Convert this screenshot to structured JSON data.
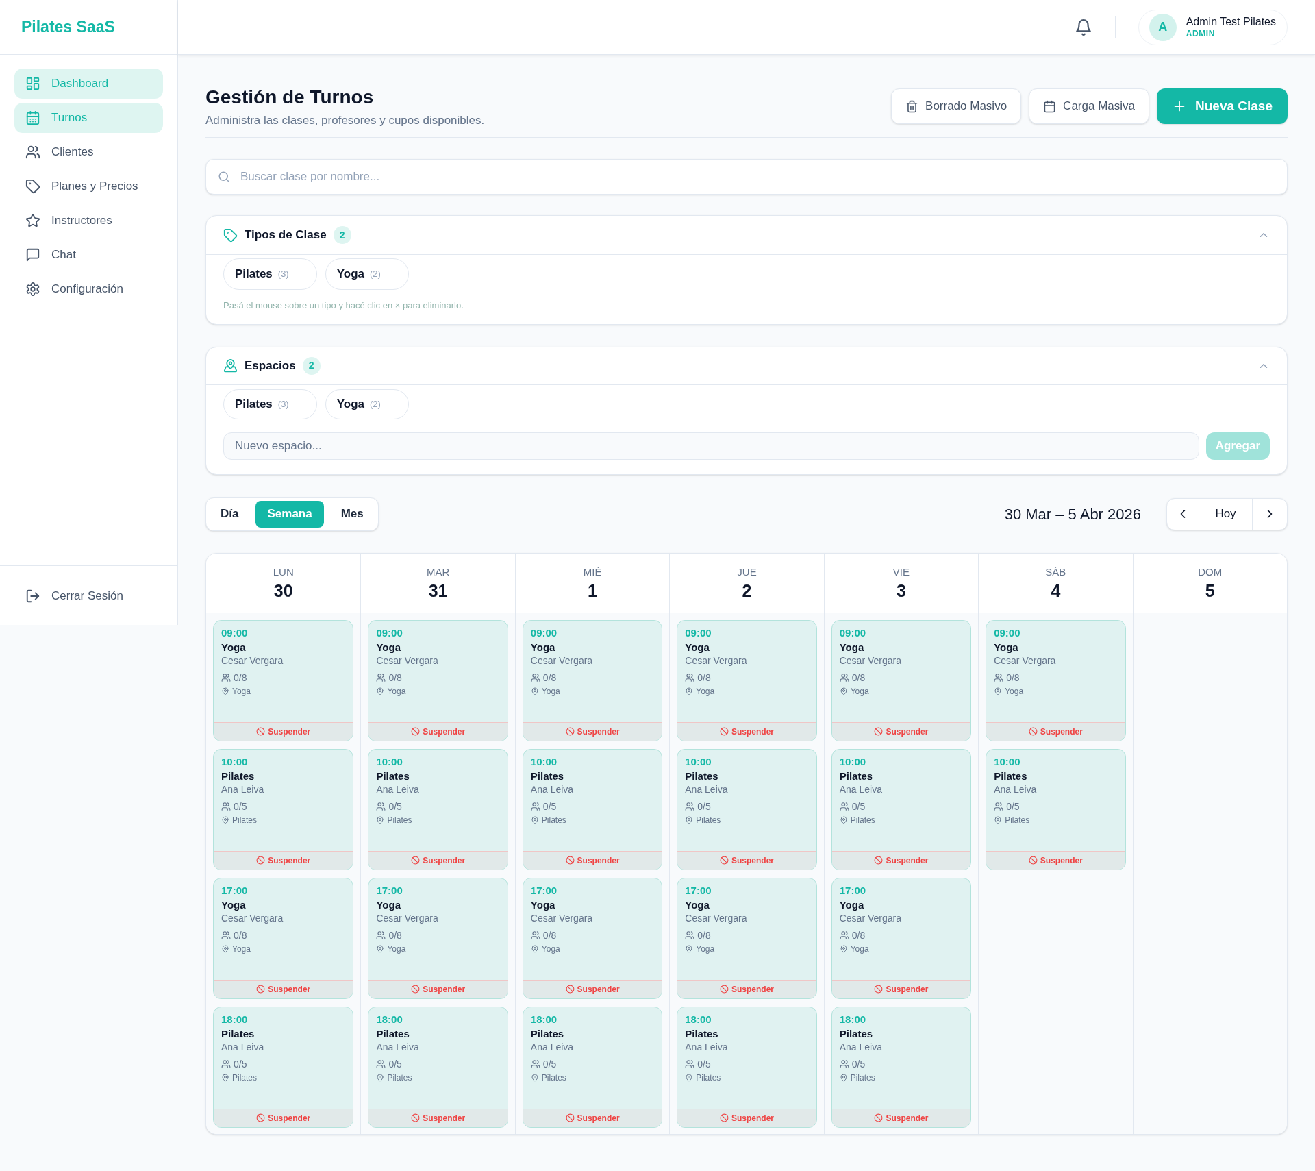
{
  "sidebar": {
    "logo": "Pilates SaaS",
    "items": [
      {
        "label": "Dashboard",
        "selected": true
      },
      {
        "label": "Turnos",
        "selected": true
      },
      {
        "label": "Clientes",
        "selected": false
      },
      {
        "label": "Planes y Precios",
        "selected": false
      },
      {
        "label": "Instructores",
        "selected": false
      },
      {
        "label": "Chat",
        "selected": false
      },
      {
        "label": "Configuración",
        "selected": false
      }
    ],
    "logout": "Cerrar Sesión"
  },
  "topbar": {
    "user": {
      "initial": "A",
      "name": "Admin Test Pilates",
      "role": "ADMIN"
    }
  },
  "page": {
    "title": "Gestión de Turnos",
    "subtitle": "Administra las clases, profesores y cupos disponibles.",
    "actions": [
      {
        "label": "Borrado Masivo",
        "kind": "secondary"
      },
      {
        "label": "Carga Masiva",
        "kind": "secondary"
      },
      {
        "label": "Nueva Clase",
        "kind": "primary"
      }
    ]
  },
  "search": {
    "placeholder": "Buscar clase por nombre..."
  },
  "class_types": {
    "title": "Tipos de Clase",
    "count": "2",
    "expanded": true,
    "chips": [
      {
        "label": "Pilates",
        "count": "(3)"
      },
      {
        "label": "Yoga",
        "count": "(2)"
      }
    ],
    "hint": "Pasá el mouse sobre un tipo y hacé clic en × para eliminarlo."
  },
  "spaces": {
    "title": "Espacios",
    "count": "2",
    "expanded": true,
    "chips": [
      {
        "label": "Pilates",
        "count": "(3)"
      },
      {
        "label": "Yoga",
        "count": "(2)"
      }
    ],
    "input": {
      "placeholder": "Nuevo espacio..."
    },
    "add_button": {
      "label": "Agregar",
      "disabled": true
    }
  },
  "view_tabs": [
    {
      "label": "Día",
      "selected": false
    },
    {
      "label": "Semana",
      "selected": true
    },
    {
      "label": "Mes",
      "selected": false
    }
  ],
  "date_range": "30 Mar – 5 Abr 2026",
  "navigation": {
    "today": "Hoy"
  },
  "calendar": {
    "days": [
      {
        "weekday": "LUN",
        "date": "30",
        "events": [
          {
            "time": "09:00",
            "title": "Yoga",
            "instructor": "Cesar Vergara",
            "capacity": "0/8",
            "location": "Yoga",
            "action": "Suspender"
          },
          {
            "time": "10:00",
            "title": "Pilates",
            "instructor": "Ana Leiva",
            "capacity": "0/5",
            "location": "Pilates",
            "action": "Suspender"
          },
          {
            "time": "17:00",
            "title": "Yoga",
            "instructor": "Cesar Vergara",
            "capacity": "0/8",
            "location": "Yoga",
            "action": "Suspender"
          },
          {
            "time": "18:00",
            "title": "Pilates",
            "instructor": "Ana Leiva",
            "capacity": "0/5",
            "location": "Pilates",
            "action": "Suspender"
          }
        ]
      },
      {
        "weekday": "MAR",
        "date": "31",
        "events": [
          {
            "time": "09:00",
            "title": "Yoga",
            "instructor": "Cesar Vergara",
            "capacity": "0/8",
            "location": "Yoga",
            "action": "Suspender"
          },
          {
            "time": "10:00",
            "title": "Pilates",
            "instructor": "Ana Leiva",
            "capacity": "0/5",
            "location": "Pilates",
            "action": "Suspender"
          },
          {
            "time": "17:00",
            "title": "Yoga",
            "instructor": "Cesar Vergara",
            "capacity": "0/8",
            "location": "Yoga",
            "action": "Suspender"
          },
          {
            "time": "18:00",
            "title": "Pilates",
            "instructor": "Ana Leiva",
            "capacity": "0/5",
            "location": "Pilates",
            "action": "Suspender"
          }
        ]
      },
      {
        "weekday": "MIÉ",
        "date": "1",
        "events": [
          {
            "time": "09:00",
            "title": "Yoga",
            "instructor": "Cesar Vergara",
            "capacity": "0/8",
            "location": "Yoga",
            "action": "Suspender"
          },
          {
            "time": "10:00",
            "title": "Pilates",
            "instructor": "Ana Leiva",
            "capacity": "0/5",
            "location": "Pilates",
            "action": "Suspender"
          },
          {
            "time": "17:00",
            "title": "Yoga",
            "instructor": "Cesar Vergara",
            "capacity": "0/8",
            "location": "Yoga",
            "action": "Suspender"
          },
          {
            "time": "18:00",
            "title": "Pilates",
            "instructor": "Ana Leiva",
            "capacity": "0/5",
            "location": "Pilates",
            "action": "Suspender"
          }
        ]
      },
      {
        "weekday": "JUE",
        "date": "2",
        "events": [
          {
            "time": "09:00",
            "title": "Yoga",
            "instructor": "Cesar Vergara",
            "capacity": "0/8",
            "location": "Yoga",
            "action": "Suspender"
          },
          {
            "time": "10:00",
            "title": "Pilates",
            "instructor": "Ana Leiva",
            "capacity": "0/5",
            "location": "Pilates",
            "action": "Suspender"
          },
          {
            "time": "17:00",
            "title": "Yoga",
            "instructor": "Cesar Vergara",
            "capacity": "0/8",
            "location": "Yoga",
            "action": "Suspender"
          },
          {
            "time": "18:00",
            "title": "Pilates",
            "instructor": "Ana Leiva",
            "capacity": "0/5",
            "location": "Pilates",
            "action": "Suspender"
          }
        ]
      },
      {
        "weekday": "VIE",
        "date": "3",
        "events": [
          {
            "time": "09:00",
            "title": "Yoga",
            "instructor": "Cesar Vergara",
            "capacity": "0/8",
            "location": "Yoga",
            "action": "Suspender"
          },
          {
            "time": "10:00",
            "title": "Pilates",
            "instructor": "Ana Leiva",
            "capacity": "0/5",
            "location": "Pilates",
            "action": "Suspender"
          },
          {
            "time": "17:00",
            "title": "Yoga",
            "instructor": "Cesar Vergara",
            "capacity": "0/8",
            "location": "Yoga",
            "action": "Suspender"
          },
          {
            "time": "18:00",
            "title": "Pilates",
            "instructor": "Ana Leiva",
            "capacity": "0/5",
            "location": "Pilates",
            "action": "Suspender"
          }
        ]
      },
      {
        "weekday": "SÁB",
        "date": "4",
        "events": [
          {
            "time": "09:00",
            "title": "Yoga",
            "instructor": "Cesar Vergara",
            "capacity": "0/8",
            "location": "Yoga",
            "action": "Suspender"
          },
          {
            "time": "10:00",
            "title": "Pilates",
            "instructor": "Ana Leiva",
            "capacity": "0/5",
            "location": "Pilates",
            "action": "Suspender"
          }
        ]
      },
      {
        "weekday": "DOM",
        "date": "5"
      }
    ]
  }
}
